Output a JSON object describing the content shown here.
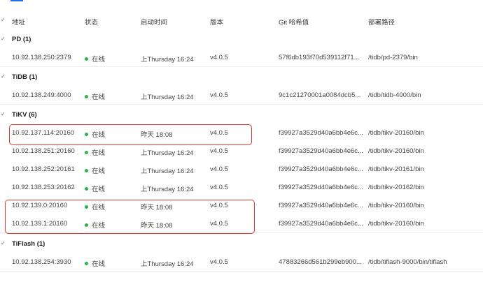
{
  "header": {
    "columns": [
      "地址",
      "状态",
      "启动时间",
      "版本",
      "Git 哈希值",
      "部署路径"
    ]
  },
  "groups": [
    {
      "label": "PD (1)",
      "rows": [
        {
          "address": "10.92.138.250:2379",
          "status": "在线",
          "start": "上Thursday 16:24",
          "version": "v4.0.5",
          "hash": "57f6db193f70d539112f71...",
          "path": "/tidb/pd-2379/bin"
        }
      ]
    },
    {
      "label": "TiDB (1)",
      "rows": [
        {
          "address": "10.92.138.249:4000",
          "status": "在线",
          "start": "上Thursday 16:24",
          "version": "v4.0.5",
          "hash": "9c1c21270001a0084dcb5...",
          "path": "/tidb/tidb-4000/bin"
        }
      ]
    },
    {
      "label": "TiKV (6)",
      "rows": [
        {
          "address": "10.92.137.114:20160",
          "status": "在线",
          "start": "昨天 18:08",
          "version": "v4.0.5",
          "hash": "f39927a3529d40a6bb4e6c...",
          "path": "/tidb/tikv-20160/bin"
        },
        {
          "address": "10.92.138.251:20160",
          "status": "在线",
          "start": "上Thursday 16:24",
          "version": "v4.0.5",
          "hash": "f39927a3529d40a6bb4e6c...",
          "path": "/tidb/tikv-20160/bin"
        },
        {
          "address": "10.92.138.252:20161",
          "status": "在线",
          "start": "上Thursday 16:24",
          "version": "v4.0.5",
          "hash": "f39927a3529d40a6bb4e6c...",
          "path": "/tidb/tikv-20161/bin"
        },
        {
          "address": "10.92.138.253:20162",
          "status": "在线",
          "start": "上Thursday 16:24",
          "version": "v4.0.5",
          "hash": "f39927a3529d40a6bb4e6c...",
          "path": "/tidb/tikv-20162/bin"
        },
        {
          "address": "10.92.139.0:20160",
          "status": "在线",
          "start": "昨天 18:08",
          "version": "v4.0.5",
          "hash": "f39927a3529d40a6bb4e6c...",
          "path": "/tidb/tikv-20160/bin"
        },
        {
          "address": "10.92.139.1:20160",
          "status": "在线",
          "start": "昨天 18:08",
          "version": "v4.0.5",
          "hash": "f39927a3529d40a6bb4e6c...",
          "path": "/tidb/tikv-20160/bin"
        }
      ]
    },
    {
      "label": "TiFlash (1)",
      "rows": [
        {
          "address": "10.92.138.254:3930",
          "status": "在线",
          "start": "上Thursday 16:24",
          "version": "v4.0.5",
          "hash": "47883266d561b299eb900...",
          "path": "/tidb/tiflash-9000/bin/tiflash"
        }
      ]
    }
  ],
  "colors": {
    "online": "#29b34a",
    "highlight": "#e2372e",
    "accent": "#1f6feb"
  },
  "icons": {
    "group_toggle": "check-icon"
  }
}
